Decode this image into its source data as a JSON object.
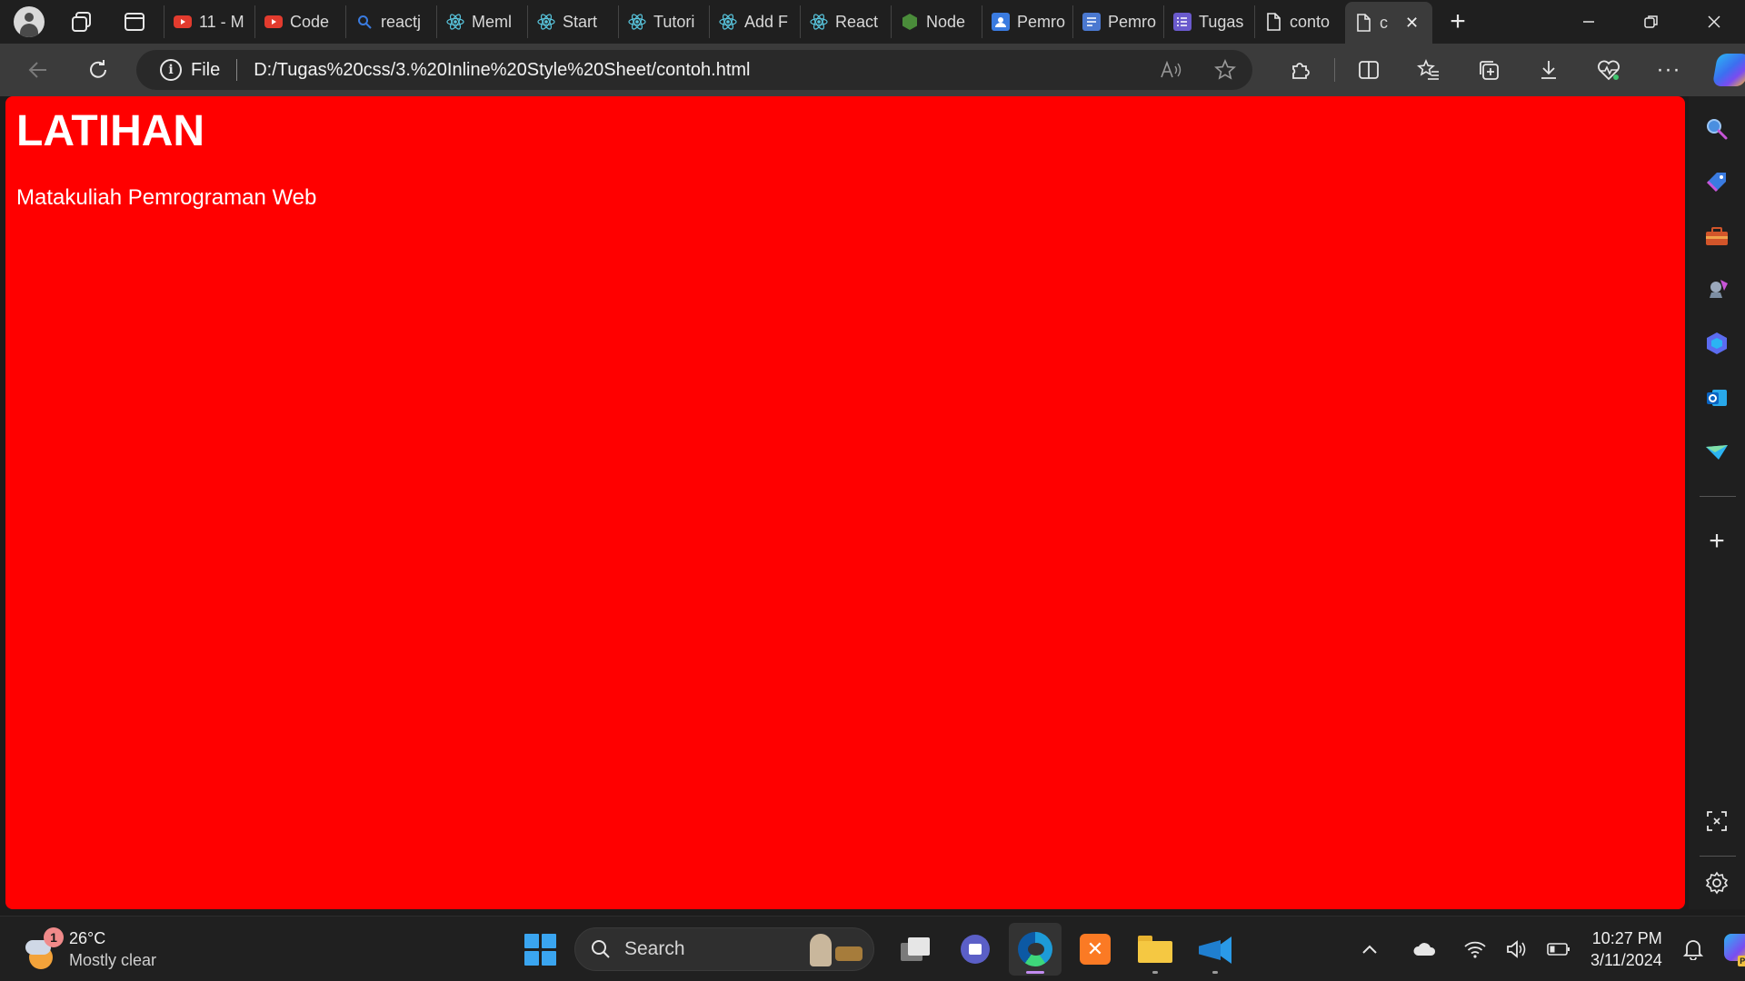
{
  "browser": {
    "tabs": [
      {
        "label": "11 - M",
        "icon": "youtube-icon",
        "color": "#e23b2e"
      },
      {
        "label": "Code",
        "icon": "youtube-icon",
        "color": "#e23b2e"
      },
      {
        "label": "reactj",
        "icon": "search-icon",
        "color": "#3a7be0"
      },
      {
        "label": "Meml",
        "icon": "react-icon",
        "color": "#58c4dc"
      },
      {
        "label": "Start",
        "icon": "react-icon",
        "color": "#58c4dc"
      },
      {
        "label": "Tutori",
        "icon": "react-icon",
        "color": "#58c4dc"
      },
      {
        "label": "Add F",
        "icon": "react-icon",
        "color": "#58c4dc"
      },
      {
        "label": "React",
        "icon": "react-icon",
        "color": "#58c4dc"
      },
      {
        "label": "Node",
        "icon": "nodejs-icon",
        "color": "#4a8c3a"
      },
      {
        "label": "Pemro",
        "icon": "contact-card-icon",
        "color": "#3a7be0"
      },
      {
        "label": "Pemro",
        "icon": "document-icon",
        "color": "#4a78d0"
      },
      {
        "label": "Tugas",
        "icon": "list-icon",
        "color": "#6a5acd"
      },
      {
        "label": "conto",
        "icon": "page-icon",
        "color": "#e6e6e6"
      },
      {
        "label": "c",
        "icon": "page-icon",
        "color": "#e6e6e6",
        "active": true
      }
    ],
    "address": {
      "scheme": "File",
      "url": "D:/Tugas%20css/3.%20Inline%20Style%20Sheet/contoh.html"
    }
  },
  "page": {
    "heading": "LATIHAN",
    "paragraph": "Matakuliah Pemrograman Web",
    "background": "#ff0000",
    "text_color": "#ffffff"
  },
  "taskbar": {
    "weather": {
      "temp": "26°C",
      "condition": "Mostly clear",
      "badge": "1"
    },
    "search_label": "Search",
    "clock": {
      "time": "10:27 PM",
      "date": "3/11/2024"
    }
  }
}
